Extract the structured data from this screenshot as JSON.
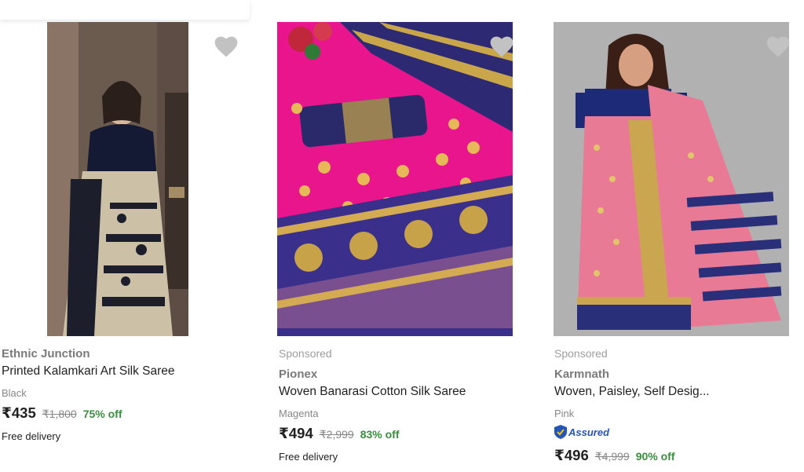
{
  "products": [
    {
      "sponsored": "",
      "brand": "Ethnic Junction",
      "title": "Printed Kalamkari Art Silk Saree",
      "color": "Black",
      "price": "₹435",
      "mrp": "₹1,800",
      "discount": "75% off",
      "delivery": "Free delivery",
      "image_icon": "saree-photo-black",
      "wishlist_icon": "heart-icon"
    },
    {
      "sponsored": "Sponsored",
      "brand": "Pionex",
      "title": "Woven Banarasi Cotton Silk Saree",
      "color": "Magenta",
      "price": "₹494",
      "mrp": "₹2,999",
      "discount": "83% off",
      "delivery": "Free delivery",
      "image_icon": "saree-photo-magenta",
      "wishlist_icon": "heart-icon"
    },
    {
      "sponsored": "Sponsored",
      "brand": "Karmnath",
      "title": "Woven, Paisley, Self Desig...",
      "color": "Pink",
      "assured": "Assured",
      "price": "₹496",
      "mrp": "₹4,999",
      "discount": "90% off",
      "image_icon": "saree-photo-pink",
      "wishlist_icon": "heart-icon"
    }
  ],
  "colors": {
    "discount": "#388e3c",
    "assured": "#2455b8",
    "heart": "#c2c2c2"
  }
}
